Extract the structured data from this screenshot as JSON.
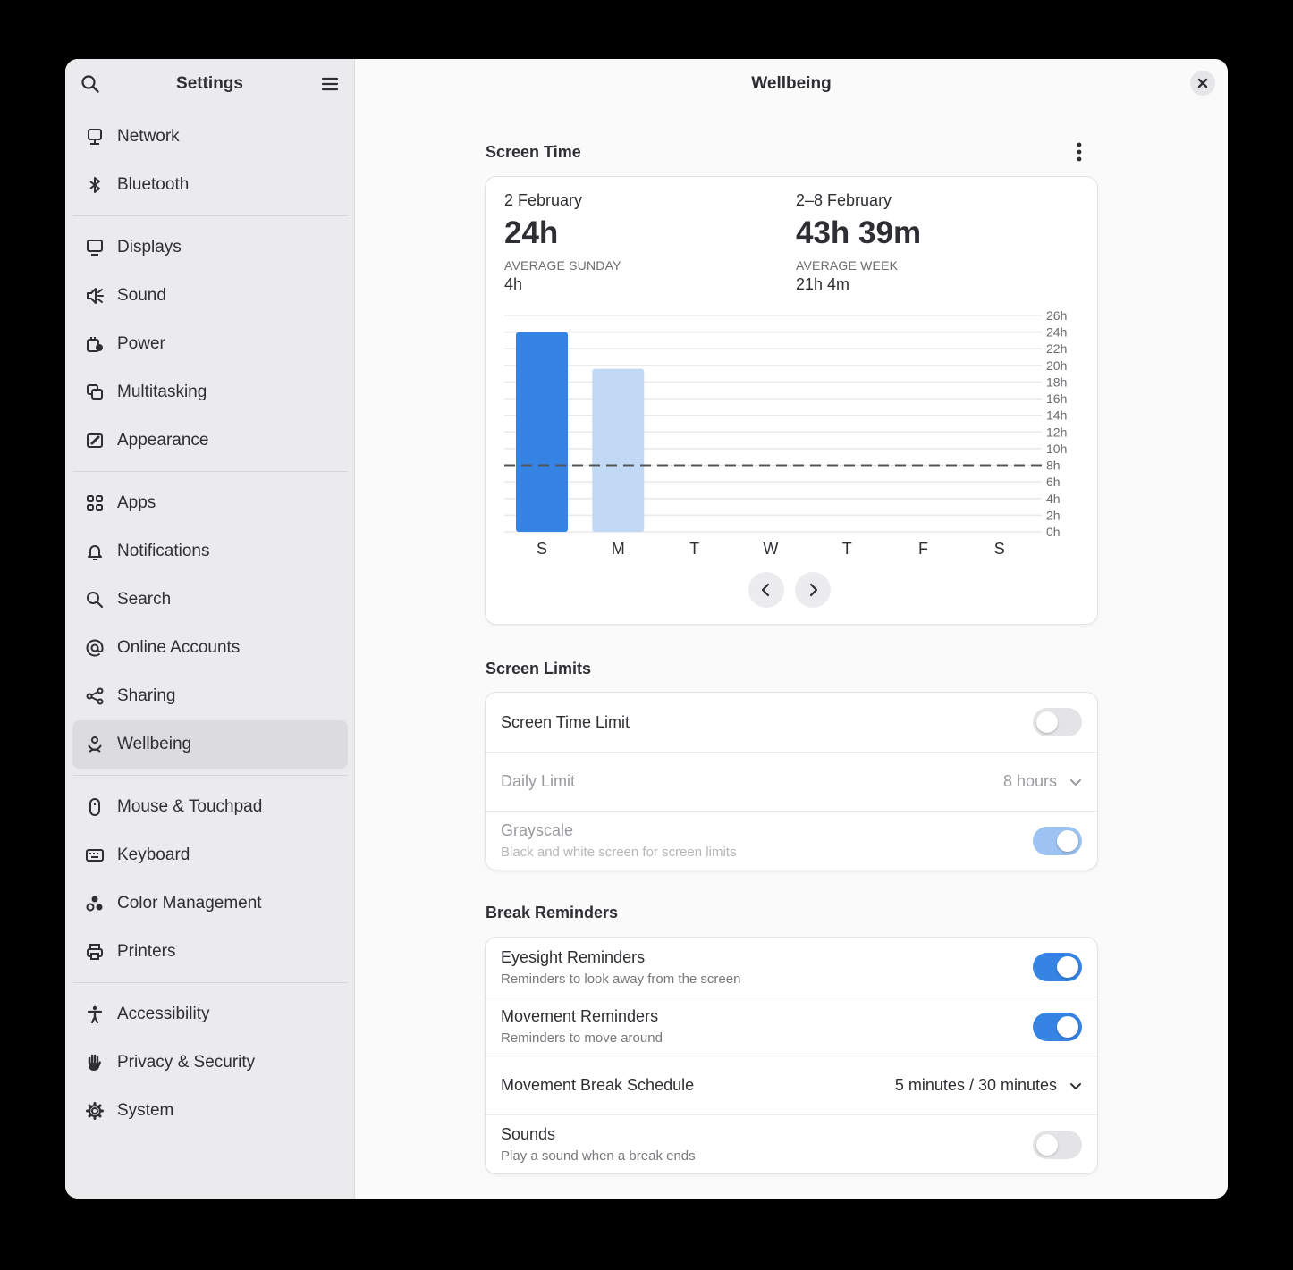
{
  "sidebar": {
    "title": "Settings",
    "items": [
      {
        "label": "Network",
        "icon": "network-icon"
      },
      {
        "label": "Bluetooth",
        "icon": "bluetooth-icon"
      },
      {
        "label": "Displays",
        "icon": "display-icon"
      },
      {
        "label": "Sound",
        "icon": "speaker-icon"
      },
      {
        "label": "Power",
        "icon": "power-icon"
      },
      {
        "label": "Multitasking",
        "icon": "multitasking-icon"
      },
      {
        "label": "Appearance",
        "icon": "appearance-icon"
      },
      {
        "label": "Apps",
        "icon": "apps-grid-icon"
      },
      {
        "label": "Notifications",
        "icon": "bell-icon"
      },
      {
        "label": "Search",
        "icon": "search-icon"
      },
      {
        "label": "Online Accounts",
        "icon": "at-sign-icon"
      },
      {
        "label": "Sharing",
        "icon": "share-icon"
      },
      {
        "label": "Wellbeing",
        "icon": "wellbeing-icon",
        "selected": true
      },
      {
        "label": "Mouse & Touchpad",
        "icon": "mouse-icon"
      },
      {
        "label": "Keyboard",
        "icon": "keyboard-icon"
      },
      {
        "label": "Color Management",
        "icon": "color-icon"
      },
      {
        "label": "Printers",
        "icon": "printer-icon"
      },
      {
        "label": "Accessibility",
        "icon": "accessibility-icon"
      },
      {
        "label": "Privacy & Security",
        "icon": "hand-icon"
      },
      {
        "label": "System",
        "icon": "gear-icon"
      }
    ]
  },
  "content": {
    "title": "Wellbeing",
    "screen_time": {
      "heading": "Screen Time",
      "day": {
        "date": "2 February",
        "total": "24h",
        "avg_label": "AVERAGE SUNDAY",
        "avg_value": "4h"
      },
      "week": {
        "date": "2–8 February",
        "total": "43h 39m",
        "avg_label": "AVERAGE WEEK",
        "avg_value": "21h 4m"
      }
    },
    "screen_limits": {
      "heading": "Screen Limits",
      "screen_time_limit": {
        "title": "Screen Time Limit",
        "on": false
      },
      "daily_limit": {
        "title": "Daily Limit",
        "value": "8 hours"
      },
      "grayscale": {
        "title": "Grayscale",
        "subtitle": "Black and white screen for screen limits",
        "on": true
      }
    },
    "break_reminders": {
      "heading": "Break Reminders",
      "eyesight": {
        "title": "Eyesight Reminders",
        "subtitle": "Reminders to look away from the screen",
        "on": true
      },
      "movement": {
        "title": "Movement Reminders",
        "subtitle": "Reminders to move around",
        "on": true
      },
      "schedule": {
        "title": "Movement Break Schedule",
        "value": "5 minutes / 30 minutes"
      },
      "sounds": {
        "title": "Sounds",
        "subtitle": "Play a sound when a break ends",
        "on": false
      }
    }
  },
  "colors": {
    "accent": "#3584e4",
    "accent_light": "#c2d9f5",
    "limit_line": "#555555"
  },
  "chart_data": {
    "type": "bar",
    "categories": [
      "S",
      "M",
      "T",
      "W",
      "T",
      "F",
      "S"
    ],
    "values": [
      24,
      19.6,
      0,
      0,
      0,
      0,
      0
    ],
    "highlighted_index": 0,
    "yticks": [
      "0h",
      "2h",
      "4h",
      "6h",
      "8h",
      "10h",
      "12h",
      "14h",
      "16h",
      "18h",
      "20h",
      "22h",
      "24h",
      "26h"
    ],
    "ylim": [
      0,
      26
    ],
    "limit_line": 8,
    "grid": true
  }
}
